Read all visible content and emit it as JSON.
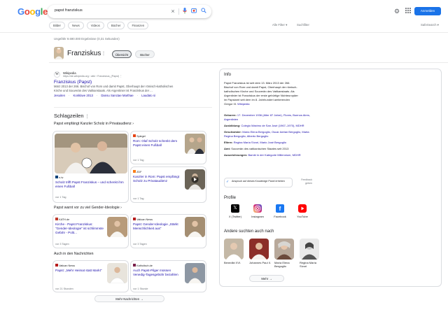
{
  "header": {
    "logo": [
      "G",
      "o",
      "o",
      "g",
      "l",
      "e"
    ],
    "query": "papst franziskus",
    "signin": "Anmelden"
  },
  "chips": [
    "Bilder",
    "News",
    "Videos",
    "Bücher",
    "Finanzen"
  ],
  "filters": {
    "all": "Alle Filter",
    "tools": "Suchfilter",
    "safe": "SafeSearch"
  },
  "stats": "Ungefähr 9.690.000 Ergebnisse (0,31 Sekunden)",
  "panel": {
    "title": "Franziskus",
    "tabs": [
      "Übersicht",
      "Bücher"
    ]
  },
  "result": {
    "site": "Wikipedia",
    "url": "https://de.wikipedia.org › wiki › Franziskus_(Papst)",
    "title": "Franziskus (Papst)",
    "snippet1": "März 2013 der 266. Bischof von Rom und damit Papst, Oberhaupt der römisch-katholischen",
    "snippet2": "Kirche und Souverän des Vatikanstaats. Als Argentinier ist Franziskus der ...",
    "links": [
      "Jesuiten",
      "Konklave 2013",
      "Dansu Sanctae Marthae",
      "Laudato si"
    ]
  },
  "news": {
    "heading": "Schlagzeilen",
    "topic1": "Papst empfängt Kanzler Scholz in Privataudienz",
    "items": [
      {
        "source": "n-tv",
        "title": "Scholz trifft Papst Franziskus – und schenkt ihm einen Fußball",
        "time": "vor 1 Tag"
      },
      {
        "source": "Spiegel",
        "title": "Rom: Olaf Scholz schenkt dem Papst einen Fußball",
        "time": "vor 1 Tag"
      },
      {
        "source": "ZDF",
        "title": "Kanzler in Rom: Papst empfängt Scholz zu Privataudienz",
        "time": "vor 1 Tag"
      }
    ],
    "topic2": "Papst warnt vor zu viel Gender-Ideologie",
    "items2": [
      {
        "source": "KATH.de",
        "title": "Kirche - Papst Franziskus: \"Gender-Ideologie\" ist schlimmste Gefahr - Polit...",
        "time": "vor 3 Tagen"
      },
      {
        "source": "Vatican News",
        "title": "Papst: Gender-Ideologie „Stärkt Menschlichkeit aus\"",
        "time": "vor 3 Tagen"
      }
    ],
    "topic3": "Auch in den Nachrichten",
    "items3": [
      {
        "source": "Vatican News",
        "title": "Papst: „Mehr Heimat statt Markt\"",
        "time": "vor 21 Stunden"
      },
      {
        "source": "Katholisch.de",
        "title": "Auch Papst-Pilger müssen Venedig-Tagesgebühr bezahlen",
        "time": "vor 1 Stunde"
      }
    ],
    "more": "Mehr Nachrichten"
  },
  "info": {
    "title": "Info",
    "desc": [
      "Papst Franziskus ist seit dem 13. März 2013 der 266.",
      "Bischof von Rom und damit Papst, Oberhaupt der römisch-",
      "katholischen Kirche und Souverän des Vatikanstaats. Als",
      "Argentinier ist Franziskus der erste gebürtige Nichteuropäer",
      "im Papstamt seit dem im 8. Jahrhundert amtierenden",
      "Gregor III.",
      "Wikipedia"
    ],
    "rows": [
      {
        "k": "Geboren:",
        "v": "17. Dezember 1936 (Alter 87 Jahre), Flores, Buenos Aires, Argentinien"
      },
      {
        "k": "Ausbildung:",
        "v": "Colegio Máximo de San José (1967–1970), MDHR"
      },
      {
        "k": "Geschwister:",
        "v": "María Elena Bergoglio, Oscar Adrian Bergoglio, Marta Regina Bergoglio, Alberto Bergoglio"
      },
      {
        "k": "Eltern:",
        "v": "Regina María Sívori, Mario José Bergoglio"
      },
      {
        "k": "Amt:",
        "v": "Souverän des vatikanischen Staates seit 2013"
      },
      {
        "k": "Auszeichnungen:",
        "v": "Bambi in der Kategorie Millennium, MDHR"
      }
    ],
    "claim": "Anspruch auf dieses Knowledge Panel erheben",
    "feedback": "Feedback geben",
    "profiles_title": "Profile",
    "profiles": [
      "X (Twitter)",
      "Instagram",
      "Facebook",
      "YouTube"
    ],
    "also_title": "Andere suchten auch nach",
    "also": [
      "Benedikt XVI.",
      "Johannes Paul II.",
      "María Elena Bergoglio",
      "Regina María Sívori"
    ],
    "more": "Mehr"
  }
}
